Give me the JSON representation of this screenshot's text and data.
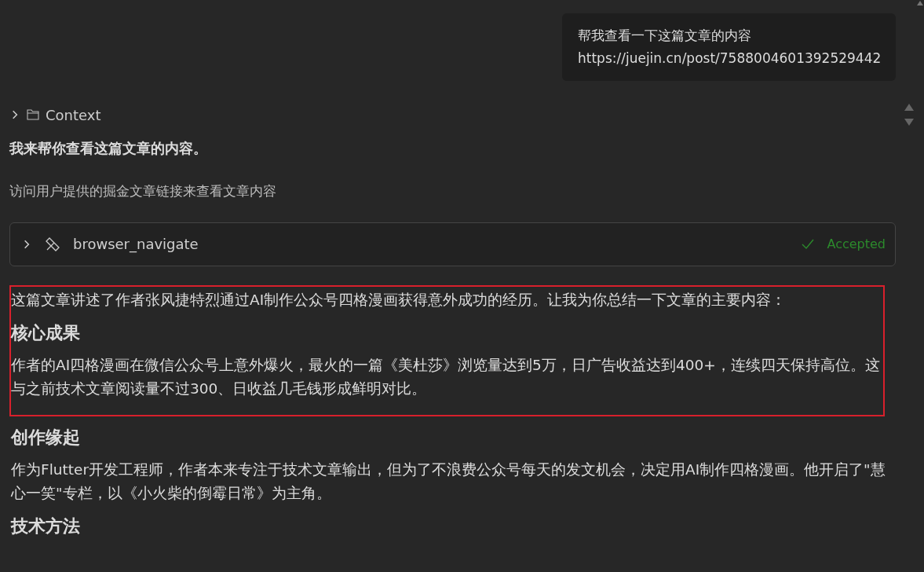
{
  "user_message": {
    "lines": [
      "帮我查看一下这篇文章的内容",
      "https://juejin.cn/post/7588004601392529442"
    ]
  },
  "context": {
    "label": "Context",
    "expanded": false
  },
  "intro": "我来帮你查看这篇文章的内容。",
  "tool_reason": "访问用户提供的掘金文章链接来查看文章内容",
  "tool_call": {
    "name": "browser_navigate",
    "expanded": false,
    "status": "Accepted"
  },
  "blocks": [
    {
      "kind": "paragraph",
      "text": "这篇文章讲述了作者张风捷特烈通过AI制作公众号四格漫画获得意外成功的经历。让我为你总结一下文章的主要内容：",
      "highlighted": true
    },
    {
      "kind": "heading",
      "text": "核心成果",
      "highlighted": true
    },
    {
      "kind": "paragraph",
      "text": "作者的AI四格漫画在微信公众号上意外爆火，最火的一篇《美杜莎》浏览量达到5万，日广告收益达到400+，连续四天保持高位。这与之前技术文章阅读量不过300、日收益几毛钱形成鲜明对比。",
      "highlighted": true
    },
    {
      "kind": "heading",
      "text": "创作缘起",
      "highlighted": false
    },
    {
      "kind": "paragraph",
      "text": "作为Flutter开发工程师，作者本来专注于技术文章输出，但为了不浪费公众号每天的发文机会，决定用AI制作四格漫画。他开启了\"慧心一笑\"专栏，以《小火柴的倒霉日常》为主角。",
      "highlighted": false
    },
    {
      "kind": "heading",
      "text": "技术方法",
      "highlighted": false
    }
  ]
}
